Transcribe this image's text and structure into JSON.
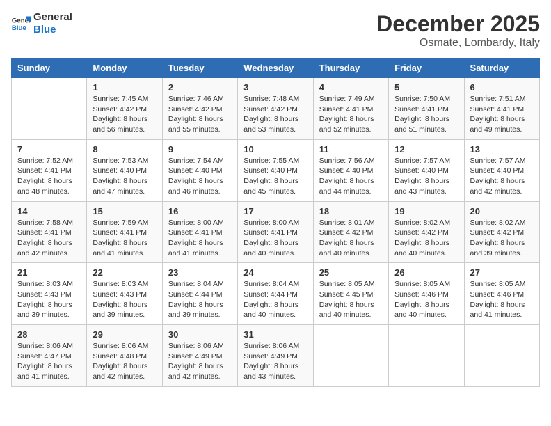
{
  "logo": {
    "line1": "General",
    "line2": "Blue"
  },
  "title": "December 2025",
  "subtitle": "Osmate, Lombardy, Italy",
  "days_of_week": [
    "Sunday",
    "Monday",
    "Tuesday",
    "Wednesday",
    "Thursday",
    "Friday",
    "Saturday"
  ],
  "weeks": [
    [
      {
        "day": "",
        "info": ""
      },
      {
        "day": "1",
        "info": "Sunrise: 7:45 AM\nSunset: 4:42 PM\nDaylight: 8 hours\nand 56 minutes."
      },
      {
        "day": "2",
        "info": "Sunrise: 7:46 AM\nSunset: 4:42 PM\nDaylight: 8 hours\nand 55 minutes."
      },
      {
        "day": "3",
        "info": "Sunrise: 7:48 AM\nSunset: 4:42 PM\nDaylight: 8 hours\nand 53 minutes."
      },
      {
        "day": "4",
        "info": "Sunrise: 7:49 AM\nSunset: 4:41 PM\nDaylight: 8 hours\nand 52 minutes."
      },
      {
        "day": "5",
        "info": "Sunrise: 7:50 AM\nSunset: 4:41 PM\nDaylight: 8 hours\nand 51 minutes."
      },
      {
        "day": "6",
        "info": "Sunrise: 7:51 AM\nSunset: 4:41 PM\nDaylight: 8 hours\nand 49 minutes."
      }
    ],
    [
      {
        "day": "7",
        "info": "Sunrise: 7:52 AM\nSunset: 4:41 PM\nDaylight: 8 hours\nand 48 minutes."
      },
      {
        "day": "8",
        "info": "Sunrise: 7:53 AM\nSunset: 4:40 PM\nDaylight: 8 hours\nand 47 minutes."
      },
      {
        "day": "9",
        "info": "Sunrise: 7:54 AM\nSunset: 4:40 PM\nDaylight: 8 hours\nand 46 minutes."
      },
      {
        "day": "10",
        "info": "Sunrise: 7:55 AM\nSunset: 4:40 PM\nDaylight: 8 hours\nand 45 minutes."
      },
      {
        "day": "11",
        "info": "Sunrise: 7:56 AM\nSunset: 4:40 PM\nDaylight: 8 hours\nand 44 minutes."
      },
      {
        "day": "12",
        "info": "Sunrise: 7:57 AM\nSunset: 4:40 PM\nDaylight: 8 hours\nand 43 minutes."
      },
      {
        "day": "13",
        "info": "Sunrise: 7:57 AM\nSunset: 4:40 PM\nDaylight: 8 hours\nand 42 minutes."
      }
    ],
    [
      {
        "day": "14",
        "info": "Sunrise: 7:58 AM\nSunset: 4:41 PM\nDaylight: 8 hours\nand 42 minutes."
      },
      {
        "day": "15",
        "info": "Sunrise: 7:59 AM\nSunset: 4:41 PM\nDaylight: 8 hours\nand 41 minutes."
      },
      {
        "day": "16",
        "info": "Sunrise: 8:00 AM\nSunset: 4:41 PM\nDaylight: 8 hours\nand 41 minutes."
      },
      {
        "day": "17",
        "info": "Sunrise: 8:00 AM\nSunset: 4:41 PM\nDaylight: 8 hours\nand 40 minutes."
      },
      {
        "day": "18",
        "info": "Sunrise: 8:01 AM\nSunset: 4:42 PM\nDaylight: 8 hours\nand 40 minutes."
      },
      {
        "day": "19",
        "info": "Sunrise: 8:02 AM\nSunset: 4:42 PM\nDaylight: 8 hours\nand 40 minutes."
      },
      {
        "day": "20",
        "info": "Sunrise: 8:02 AM\nSunset: 4:42 PM\nDaylight: 8 hours\nand 39 minutes."
      }
    ],
    [
      {
        "day": "21",
        "info": "Sunrise: 8:03 AM\nSunset: 4:43 PM\nDaylight: 8 hours\nand 39 minutes."
      },
      {
        "day": "22",
        "info": "Sunrise: 8:03 AM\nSunset: 4:43 PM\nDaylight: 8 hours\nand 39 minutes."
      },
      {
        "day": "23",
        "info": "Sunrise: 8:04 AM\nSunset: 4:44 PM\nDaylight: 8 hours\nand 39 minutes."
      },
      {
        "day": "24",
        "info": "Sunrise: 8:04 AM\nSunset: 4:44 PM\nDaylight: 8 hours\nand 40 minutes."
      },
      {
        "day": "25",
        "info": "Sunrise: 8:05 AM\nSunset: 4:45 PM\nDaylight: 8 hours\nand 40 minutes."
      },
      {
        "day": "26",
        "info": "Sunrise: 8:05 AM\nSunset: 4:46 PM\nDaylight: 8 hours\nand 40 minutes."
      },
      {
        "day": "27",
        "info": "Sunrise: 8:05 AM\nSunset: 4:46 PM\nDaylight: 8 hours\nand 41 minutes."
      }
    ],
    [
      {
        "day": "28",
        "info": "Sunrise: 8:06 AM\nSunset: 4:47 PM\nDaylight: 8 hours\nand 41 minutes."
      },
      {
        "day": "29",
        "info": "Sunrise: 8:06 AM\nSunset: 4:48 PM\nDaylight: 8 hours\nand 42 minutes."
      },
      {
        "day": "30",
        "info": "Sunrise: 8:06 AM\nSunset: 4:49 PM\nDaylight: 8 hours\nand 42 minutes."
      },
      {
        "day": "31",
        "info": "Sunrise: 8:06 AM\nSunset: 4:49 PM\nDaylight: 8 hours\nand 43 minutes."
      },
      {
        "day": "",
        "info": ""
      },
      {
        "day": "",
        "info": ""
      },
      {
        "day": "",
        "info": ""
      }
    ]
  ]
}
